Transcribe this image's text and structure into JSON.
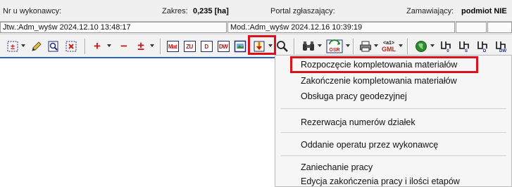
{
  "info": {
    "nr_label": "Nr u wykonawcy:",
    "zakres_label": "Zakres:",
    "zakres_value": "0,235 [ha]",
    "portal_label": "Portal zgłaszający:",
    "zamawiajacy_label": "Zamawiający:",
    "zamawiajacy_value": "podmiot NIE"
  },
  "stamps": {
    "created": "Jtw.:Adm_wyśw 2024.12.10 13:48:17",
    "modified": "Mod.:Adm_wyśw 2024.12.16 10:39:19"
  },
  "toolbar": {
    "doc_buttons": [
      "Mat",
      "ZU",
      "D",
      "DW"
    ],
    "osr_label": "OSR",
    "gml_label": "GML",
    "gml_top": "<a1>",
    "right_doc_buttons": [
      "0",
      "S",
      "D",
      "DW"
    ],
    "frame_color": "#d9121b"
  },
  "menu": {
    "items": [
      "Rozpoczęcie kompletowania materiałów",
      "Zakończenie kompletowania materiałów",
      "Obsługa pracy geodezyjnej",
      "Rezerwacja numerów działek",
      "Oddanie operatu przez wykonawcę",
      "Zaniechanie pracy",
      "Edycja zakończenia pracy i ilości etapów"
    ],
    "highlighted_index": 0
  }
}
